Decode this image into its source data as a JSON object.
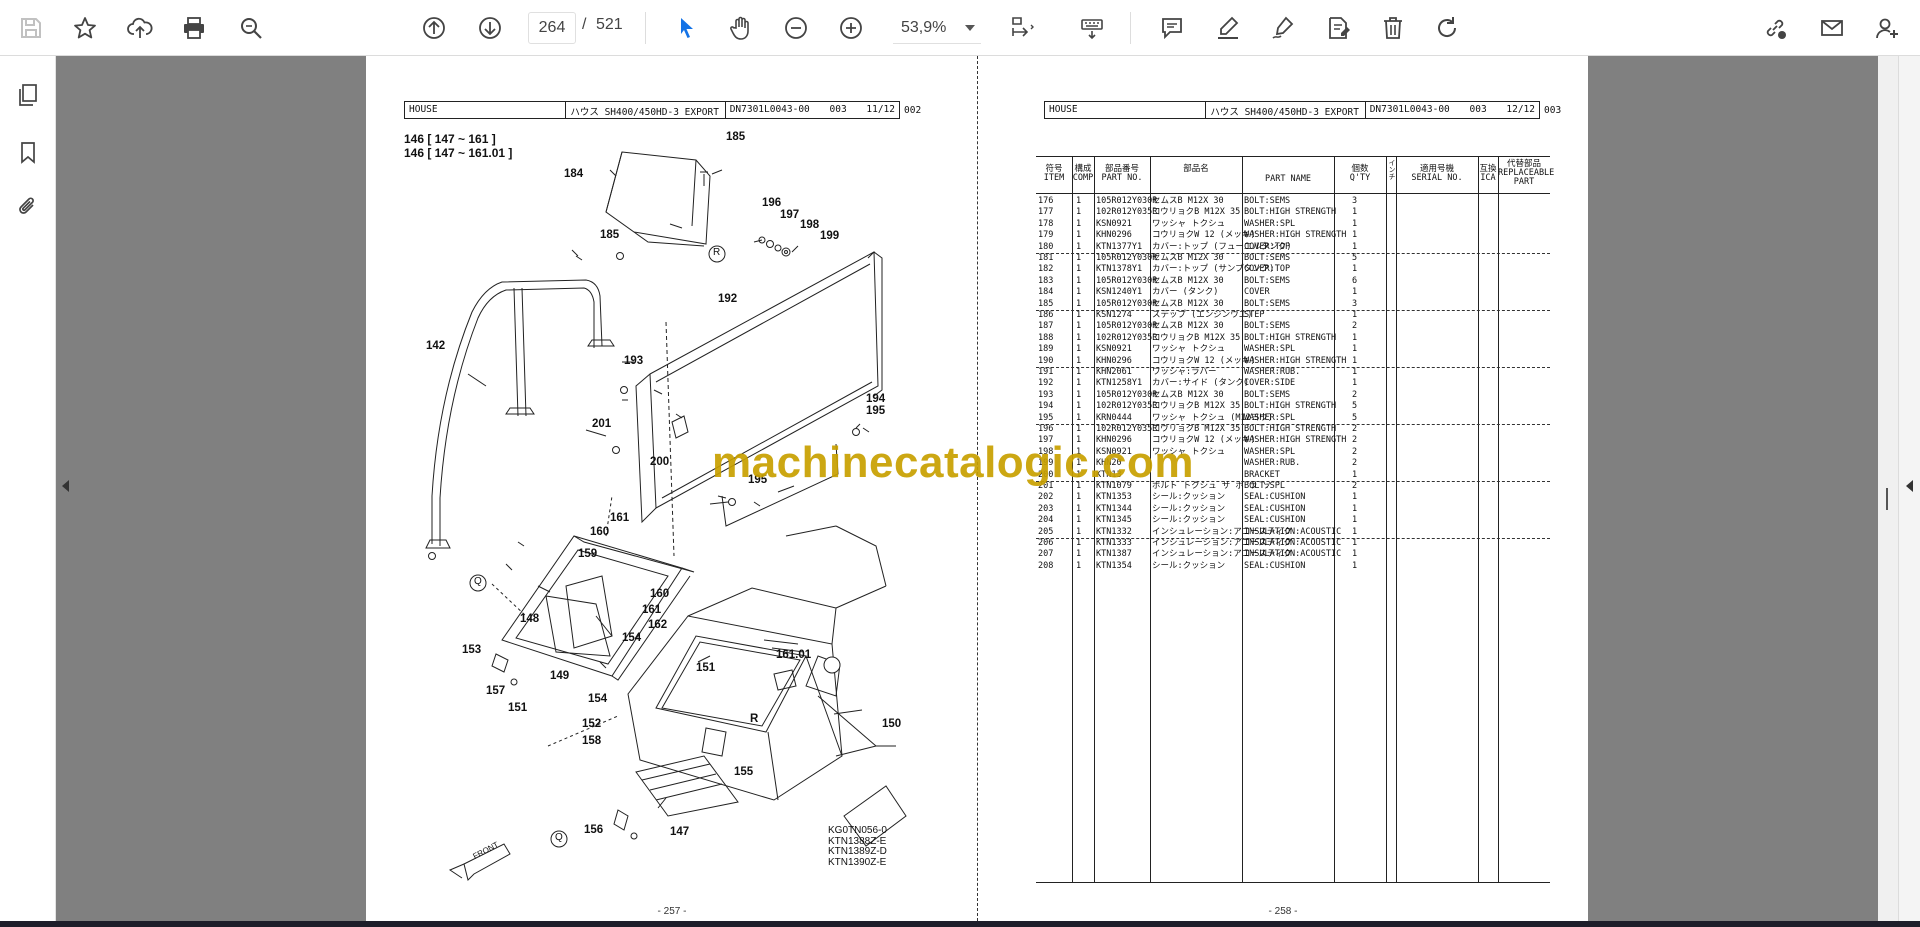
{
  "toolbar": {
    "page_current": "264",
    "page_separator": "/",
    "page_total": "521",
    "zoom": "53,9%"
  },
  "left_page": {
    "header": {
      "section": "HOUSE",
      "title": "ハウス SH400/450HD-3 EXPORT",
      "code": "DN7301L0043-00",
      "rev": "003",
      "sheet": "11/12",
      "suffix": "002"
    },
    "refs": [
      "146 [ 147 ~ 161 ]",
      "146 [ 147 ~ 161.01 ]"
    ],
    "callouts": [
      "185",
      "184",
      "R",
      "196",
      "197",
      "198",
      "199",
      "185",
      "192",
      "142",
      "193",
      "194",
      "195",
      "201",
      "200",
      "195",
      "Q",
      "161",
      "160",
      "159",
      "160",
      "161",
      "148",
      "154",
      "162",
      "153",
      "149",
      "R",
      "151",
      "161.01",
      "157",
      "151",
      "154",
      "152",
      "158",
      "150",
      "155",
      "Q",
      "156",
      "147"
    ],
    "front_label": "FRONT",
    "codes": [
      "KG0TN056-0",
      "KTN1388Z-E",
      "KTN1389Z-D",
      "KTN1390Z-E"
    ],
    "page_number": "- 257 -"
  },
  "right_page": {
    "header": {
      "section": "HOUSE",
      "title": "ハウス SH400/450HD-3 EXPORT",
      "code": "DN7301L0043-00",
      "rev": "003",
      "sheet": "12/12",
      "suffix": "003"
    },
    "columns": [
      {
        "jp": "符号",
        "en": "ITEM"
      },
      {
        "jp": "構成",
        "en": "COMP"
      },
      {
        "jp": "部品番号",
        "en": "PART NO."
      },
      {
        "jp": "部品名",
        "en": ""
      },
      {
        "jp": "",
        "en": "PART NAME"
      },
      {
        "jp": "個数",
        "en": "Q'TY"
      },
      {
        "jp": "インチ",
        "en": ""
      },
      {
        "jp": "適用号機",
        "en": "SERIAL NO."
      },
      {
        "jp": "互換",
        "en": "ICA"
      },
      {
        "jp": "代替部品",
        "en": "REPLACEABLE PART"
      }
    ],
    "rows": [
      {
        "item": "176",
        "comp": "1",
        "part_no": "105R012Y030R",
        "jp": "セムスB M12X 30",
        "name": "BOLT:SEMS",
        "qty": "3"
      },
      {
        "item": "177",
        "comp": "1",
        "part_no": "102R012Y035R",
        "jp": "コウリョクB M12X 35",
        "name": "BOLT:HIGH STRENGTH",
        "qty": "1"
      },
      {
        "item": "178",
        "comp": "1",
        "part_no": "KSN0921",
        "jp": "ワッシャ トクシュ",
        "name": "WASHER:SPL",
        "qty": "1"
      },
      {
        "item": "179",
        "comp": "1",
        "part_no": "KHN0296",
        "jp": "コウリョクW 12 (メッキ)",
        "name": "WASHER:HIGH STRENGTH",
        "qty": "1"
      },
      {
        "item": "180",
        "comp": "1",
        "part_no": "KTN1377Y1",
        "jp": "カバー:トップ (フューエルタンク)",
        "name": "COVER:TOP",
        "qty": "1"
      },
      {
        "item": "181",
        "comp": "1",
        "part_no": "105R012Y030R",
        "jp": "セムスB M12X 30",
        "name": "BOLT:SEMS",
        "qty": "5"
      },
      {
        "item": "182",
        "comp": "1",
        "part_no": "KTN1378Y1",
        "jp": "カバー:トップ (サンプタンク)",
        "name": "COVER:TOP",
        "qty": "1"
      },
      {
        "item": "183",
        "comp": "1",
        "part_no": "105R012Y030R",
        "jp": "セムスB M12X 30",
        "name": "BOLT:SEMS",
        "qty": "6"
      },
      {
        "item": "184",
        "comp": "1",
        "part_no": "KSN1240Y1",
        "jp": "カバー (タンク)",
        "name": "COVER",
        "qty": "1"
      },
      {
        "item": "185",
        "comp": "1",
        "part_no": "105R012Y030R",
        "jp": "セムスB M12X 30",
        "name": "BOLT:SEMS",
        "qty": "3"
      },
      {
        "item": "186",
        "comp": "1",
        "part_no": "KSN1274",
        "jp": "ステップ (エンジンウエ)",
        "name": "STEP",
        "qty": "1"
      },
      {
        "item": "187",
        "comp": "1",
        "part_no": "105R012Y030R",
        "jp": "セムスB M12X 30",
        "name": "BOLT:SEMS",
        "qty": "2"
      },
      {
        "item": "188",
        "comp": "1",
        "part_no": "102R012Y035R",
        "jp": "コウリョクB M12X 35",
        "name": "BOLT:HIGH STRENGTH",
        "qty": "1"
      },
      {
        "item": "189",
        "comp": "1",
        "part_no": "KSN0921",
        "jp": "ワッシャ トクシュ",
        "name": "WASHER:SPL",
        "qty": "1"
      },
      {
        "item": "190",
        "comp": "1",
        "part_no": "KHN0296",
        "jp": "コウリョクW 12 (メッキ)",
        "name": "WASHER:HIGH STRENGTH",
        "qty": "1"
      },
      {
        "item": "191",
        "comp": "1",
        "part_no": "KHN2061",
        "jp": "ワッシャ:ラバー",
        "name": "WASHER:RUB.",
        "qty": "1"
      },
      {
        "item": "192",
        "comp": "1",
        "part_no": "KTN1258Y1",
        "jp": "カバー:サイド (タンク)",
        "name": "COVER:SIDE",
        "qty": "1"
      },
      {
        "item": "193",
        "comp": "1",
        "part_no": "105R012Y030R",
        "jp": "セムスB M12X 30",
        "name": "BOLT:SEMS",
        "qty": "2"
      },
      {
        "item": "194",
        "comp": "1",
        "part_no": "102R012Y035R",
        "jp": "コウリョクB M12X 35",
        "name": "BOLT:HIGH STRENGTH",
        "qty": "5"
      },
      {
        "item": "195",
        "comp": "1",
        "part_no": "KRN0444",
        "jp": "ワッシャ トクシュ (M12ヨウ)",
        "name": "WASHER:SPL",
        "qty": "5"
      },
      {
        "item": "196",
        "comp": "1",
        "part_no": "102R012Y035R",
        "jp": "コウリョクB M12X 35",
        "name": "BOLT:HIGH STRENGTH",
        "qty": "2"
      },
      {
        "item": "197",
        "comp": "1",
        "part_no": "KHN0296",
        "jp": "コウリョクW 12 (メッキ)",
        "name": "WASHER:HIGH STRENGTH",
        "qty": "2"
      },
      {
        "item": "198",
        "comp": "1",
        "part_no": "KSN0921",
        "jp": "ワッシャ トクシュ",
        "name": "WASHER:SPL",
        "qty": "2"
      },
      {
        "item": "199",
        "comp": "1",
        "part_no": "KHN20",
        "jp": "",
        "name": "WASHER:RUB.",
        "qty": "2"
      },
      {
        "item": "200",
        "comp": "1",
        "part_no": "KTN13",
        "jp": "",
        "name": "BRACKET",
        "qty": "1"
      },
      {
        "item": "201",
        "comp": "1",
        "part_no": "KTN1079",
        "jp": "ボルト トクシュ サ ボ ラ ソ",
        "name": "BOLT:SPL",
        "qty": "2"
      },
      {
        "item": "202",
        "comp": "1",
        "part_no": "KTN1353",
        "jp": "シール:クッション",
        "name": "SEAL:CUSHION",
        "qty": "1"
      },
      {
        "item": "203",
        "comp": "1",
        "part_no": "KTN1344",
        "jp": "シール:クッション",
        "name": "SEAL:CUSHION",
        "qty": "1"
      },
      {
        "item": "204",
        "comp": "1",
        "part_no": "KTN1345",
        "jp": "シール:クッション",
        "name": "SEAL:CUSHION",
        "qty": "1"
      },
      {
        "item": "205",
        "comp": "1",
        "part_no": "KTN1332",
        "jp": "インシュレーション:アコースティク",
        "name": "INSULATION:ACOUSTIC",
        "qty": "1"
      },
      {
        "item": "206",
        "comp": "1",
        "part_no": "KTN1333",
        "jp": "インシュレーション:アコースティク",
        "name": "INSULATION:ACOUSTIC",
        "qty": "1"
      },
      {
        "item": "207",
        "comp": "1",
        "part_no": "KTN1387",
        "jp": "インシュレーション:アコースティク",
        "name": "INSULATION:ACOUSTIC",
        "qty": "1"
      },
      {
        "item": "208",
        "comp": "1",
        "part_no": "KTN1354",
        "jp": "シール:クッション",
        "name": "SEAL:CUSHION",
        "qty": "1"
      }
    ],
    "page_number": "- 258 -"
  },
  "watermark": "machinecatalogic.com"
}
